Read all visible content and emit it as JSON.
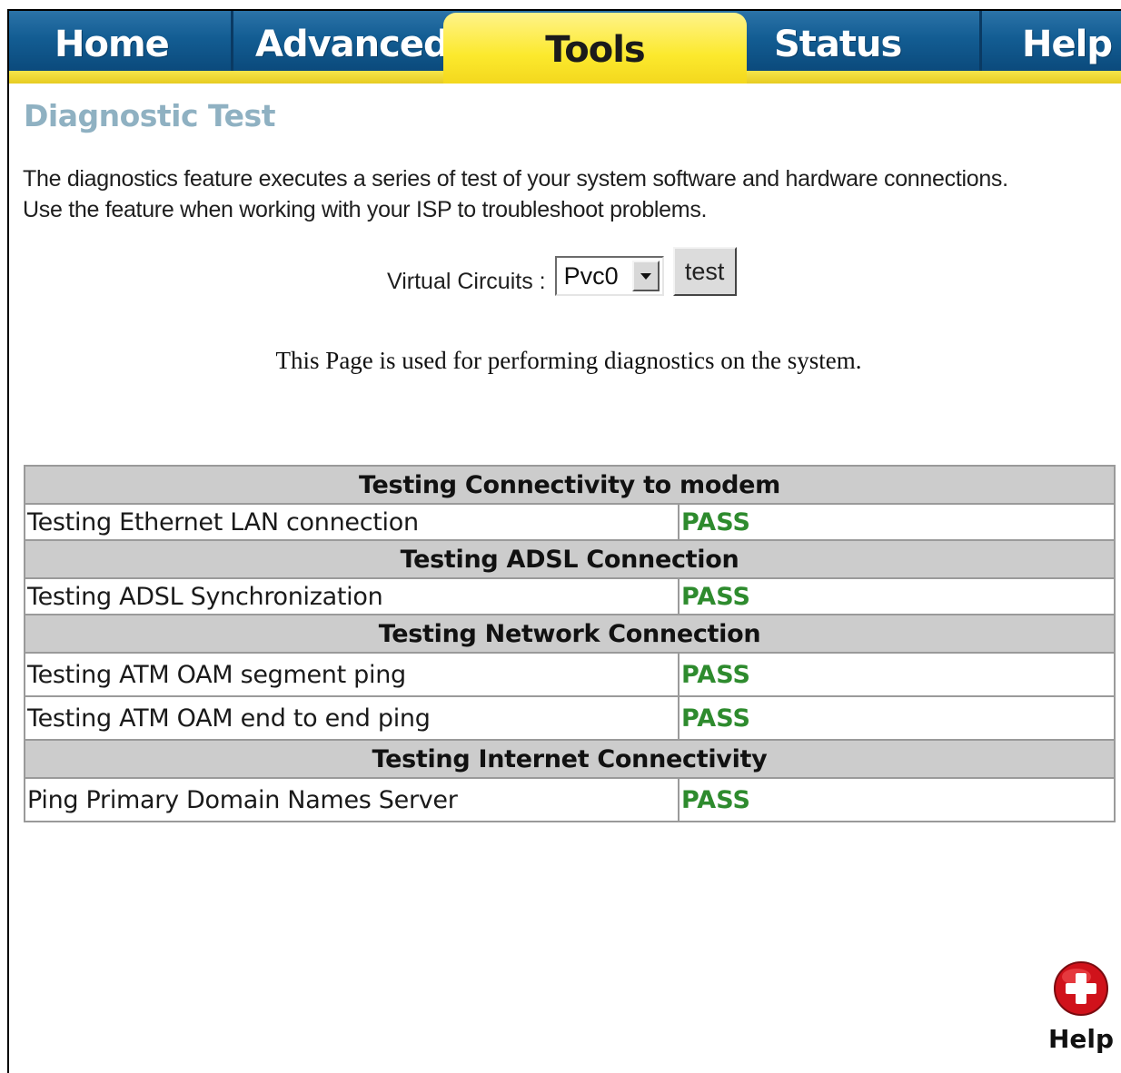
{
  "nav": {
    "tabs": [
      {
        "label": "Home",
        "active": false
      },
      {
        "label": "Advanced",
        "active": false
      },
      {
        "label": "Tools",
        "active": true
      },
      {
        "label": "Status",
        "active": false
      },
      {
        "label": "Help",
        "active": false
      }
    ]
  },
  "page": {
    "title": "Diagnostic Test",
    "description": "The diagnostics feature executes a series of test of your system software and hardware connections. Use the feature when working with your ISP to troubleshoot problems.",
    "note": "This Page is used for performing diagnostics on the system."
  },
  "virtual_circuits": {
    "label": "Virtual Circuits :",
    "selected": "Pvc0",
    "button_label": "test"
  },
  "results": {
    "sections": [
      {
        "title": "Testing Connectivity to modem",
        "tests": [
          {
            "name": "Testing Ethernet LAN connection",
            "result": "PASS"
          }
        ]
      },
      {
        "title": "Testing ADSL Connection",
        "tests": [
          {
            "name": "Testing ADSL Synchronization",
            "result": "PASS"
          }
        ]
      },
      {
        "title": "Testing Network Connection",
        "tests": [
          {
            "name": "Testing ATM OAM segment ping",
            "result": "PASS"
          },
          {
            "name": "Testing ATM OAM end to end ping",
            "result": "PASS"
          }
        ]
      },
      {
        "title": "Testing Internet Connectivity",
        "tests": [
          {
            "name": "Ping Primary Domain Names Server",
            "result": "PASS"
          }
        ]
      }
    ],
    "pass_color": "#2e8b2e"
  },
  "help": {
    "label": "Help",
    "icon": "plus-circle-icon",
    "icon_color": "#d0121b"
  },
  "colors": {
    "tab_blue": "#135d93",
    "tab_active_yellow": "#fce92d",
    "title_color": "#8fb1c2",
    "section_header_bg": "#cccccc"
  }
}
